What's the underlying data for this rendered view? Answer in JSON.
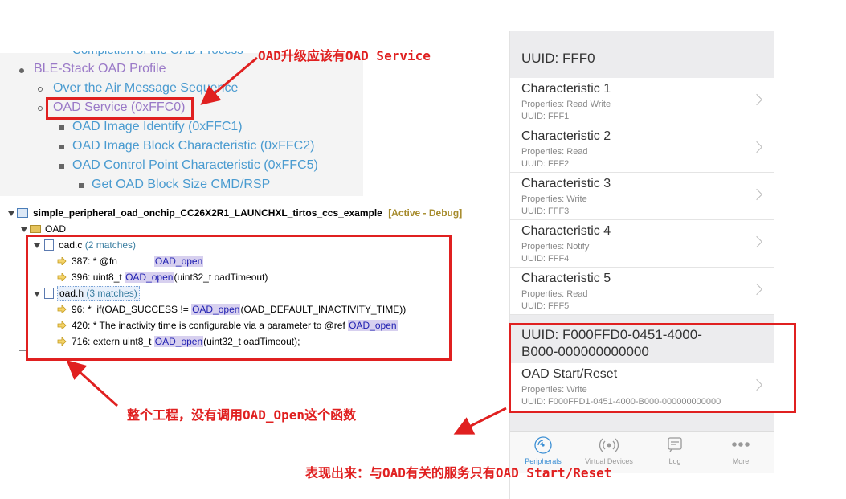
{
  "doc": {
    "cut_text": "Completion of the OAD Process",
    "items": [
      {
        "level": 1,
        "label": "BLE-Stack OAD Profile",
        "visited": true
      },
      {
        "level": 2,
        "label": "Over the Air Message Sequence",
        "visited": false
      },
      {
        "level": 2,
        "label": "OAD Service (0xFFC0)",
        "visited": true
      },
      {
        "level": 3,
        "label": "OAD Image Identify (0xFFC1)",
        "visited": false
      },
      {
        "level": 3,
        "label": "OAD Image Block Characteristic (0xFFC2)",
        "visited": false
      },
      {
        "level": 3,
        "label": "OAD Control Point Characteristic (0xFFC5)",
        "visited": false
      },
      {
        "level": 4,
        "label": "Get OAD Block Size CMD/RSP",
        "visited": false
      }
    ]
  },
  "search": {
    "project": "simple_peripheral_oad_onchip_CC26X2R1_LAUNCHXL_tirtos_ccs_example",
    "project_status_open": "[Active",
    "project_status_sep": " - ",
    "project_status_mode": "Debug]",
    "folder": "OAD",
    "files": [
      {
        "name": "oad.c",
        "count": "(2 matches)",
        "matches": [
          {
            "line": "387:",
            "pre": "* @fn      ",
            "hit": "OAD_open",
            "post": ""
          },
          {
            "line": "396:",
            "pre": "uint8_t ",
            "hit": "OAD_open",
            "post": "(uint32_t oadTimeout)"
          }
        ]
      },
      {
        "name": "oad.h",
        "count": "(3 matches)",
        "matches": [
          {
            "line": "96:",
            "pre": "*  if(OAD_SUCCESS != ",
            "hit": "OAD_open",
            "post": "(OAD_DEFAULT_INACTIVITY_TIME))"
          },
          {
            "line": "420:",
            "pre": "* The inactivity time is configurable via a parameter to @ref ",
            "hit": "OAD_open",
            "post": ""
          },
          {
            "line": "716:",
            "pre": "extern uint8_t ",
            "hit": "OAD_open",
            "post": "(uint32_t oadTimeout);"
          }
        ]
      }
    ]
  },
  "annotations": {
    "top": "OAD升级应该有OAD Service",
    "middle": "整个工程，没有调用OAD_Open这个函数",
    "bottom": "表现出来：与OAD有关的服务只有OAD Start/Reset"
  },
  "phone": {
    "service1_uuid": "UUID: FFF0",
    "characteristics": [
      {
        "name": "Characteristic 1",
        "props": "Properties: Read Write",
        "uuid": "UUID: FFF1"
      },
      {
        "name": "Characteristic 2",
        "props": "Properties: Read",
        "uuid": "UUID: FFF2"
      },
      {
        "name": "Characteristic 3",
        "props": "Properties: Write",
        "uuid": "UUID: FFF3"
      },
      {
        "name": "Characteristic 4",
        "props": "Properties: Notify",
        "uuid": "UUID: FFF4"
      },
      {
        "name": "Characteristic 5",
        "props": "Properties: Read",
        "uuid": "UUID: FFF5"
      }
    ],
    "service2_uuid_line1": "UUID: F000FFD0-0451-4000-",
    "service2_uuid_line2": "B000-000000000000",
    "oad_char": {
      "name": "OAD Start/Reset",
      "props": "Properties: Write",
      "uuid": "UUID: F000FFD1-0451-4000-B000-000000000000"
    },
    "tabs": [
      {
        "label": "Peripherals",
        "icon": "peripherals-icon",
        "active": true
      },
      {
        "label": "Virtual Devices",
        "icon": "virtual-devices-icon",
        "active": false
      },
      {
        "label": "Log",
        "icon": "log-icon",
        "active": false
      },
      {
        "label": "More",
        "icon": "more-icon",
        "active": false
      }
    ]
  },
  "colors": {
    "annotation_red": "#e02020",
    "link_blue": "#4a9bd0",
    "visited_purple": "#9a79c7",
    "highlight": "#d7d0ef",
    "tab_active": "#3b8fd4"
  }
}
